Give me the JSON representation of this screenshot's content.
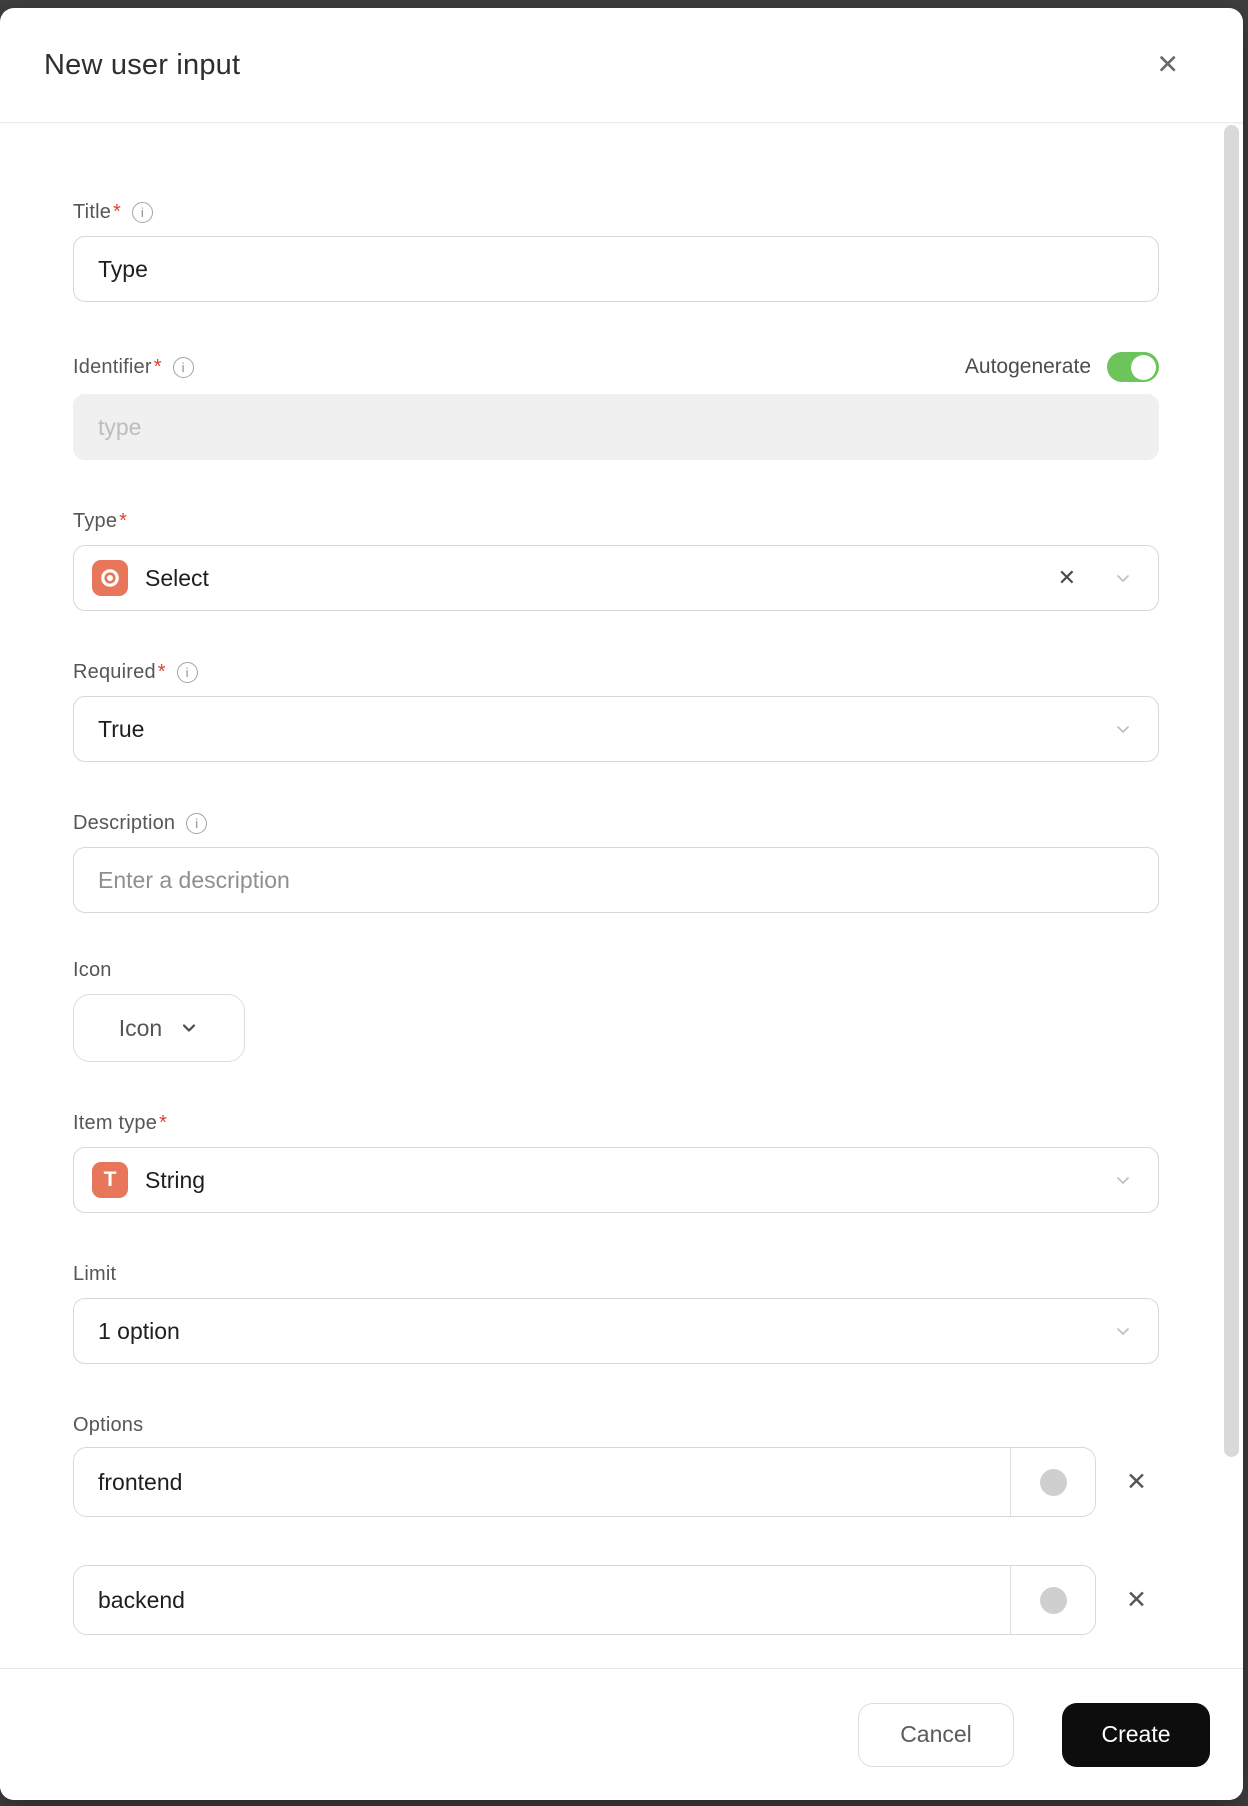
{
  "modal": {
    "title": "New user input"
  },
  "required_marker": "*",
  "icons": {
    "close": "✕",
    "info": "i",
    "clear": "✕",
    "remove": "✕",
    "string_glyph": "T"
  },
  "fields": {
    "title": {
      "label": "Title",
      "required": true,
      "value": "Type"
    },
    "identifier": {
      "label": "Identifier",
      "required": true,
      "placeholder": "type",
      "autogenerate_label": "Autogenerate",
      "autogenerate_on": true
    },
    "type": {
      "label": "Type",
      "required": true,
      "value": "Select"
    },
    "required": {
      "label": "Required",
      "required": true,
      "value": "True"
    },
    "description": {
      "label": "Description",
      "placeholder": "Enter a description"
    },
    "icon": {
      "label": "Icon",
      "button_label": "Icon"
    },
    "item_type": {
      "label": "Item type",
      "required": true,
      "value": "String"
    },
    "limit": {
      "label": "Limit",
      "value": "1 option"
    },
    "options": {
      "label": "Options",
      "items": [
        {
          "value": "frontend"
        },
        {
          "value": "backend"
        }
      ]
    }
  },
  "footer": {
    "cancel_label": "Cancel",
    "create_label": "Create"
  },
  "colors": {
    "accent": "#e8765a",
    "green": "#6cc45a",
    "red": "#e0402f",
    "btn-dark": "#0d0d0d"
  }
}
